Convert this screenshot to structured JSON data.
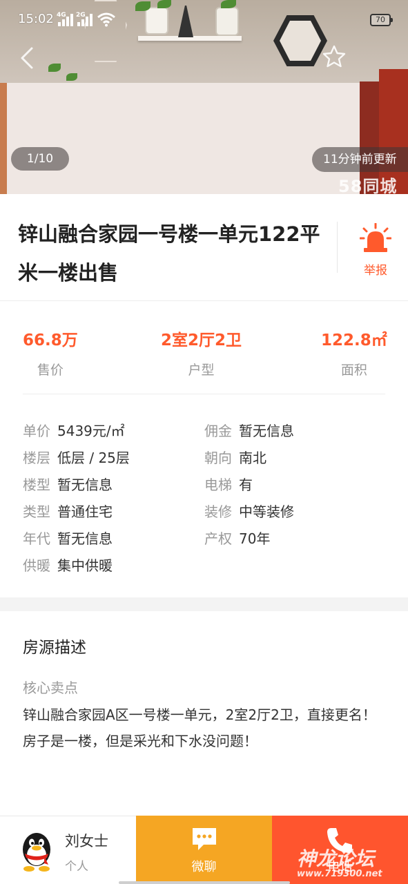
{
  "status_bar": {
    "time": "15:02",
    "signal1_label": "4G",
    "signal2_label": "2G",
    "battery": "70"
  },
  "gallery": {
    "counter": "1/10",
    "updated": "11分钟前更新",
    "watermark": "58同城"
  },
  "listing": {
    "title": "锌山融合家园一号楼一单元122平米一楼出售",
    "report_label": "举报"
  },
  "stats": [
    {
      "value": "66.8万",
      "label": "售价"
    },
    {
      "value": "2室2厅2卫",
      "label": "户型"
    },
    {
      "value": "122.8㎡",
      "label": "面积"
    }
  ],
  "details": [
    {
      "key": "单价",
      "value": "5439元/㎡"
    },
    {
      "key": "佣金",
      "value": "暂无信息"
    },
    {
      "key": "楼层",
      "value": "低层 / 25层"
    },
    {
      "key": "朝向",
      "value": "南北"
    },
    {
      "key": "楼型",
      "value": "暂无信息"
    },
    {
      "key": "电梯",
      "value": "有"
    },
    {
      "key": "类型",
      "value": "普通住宅"
    },
    {
      "key": "装修",
      "value": "中等装修"
    },
    {
      "key": "年代",
      "value": "暂无信息"
    },
    {
      "key": "产权",
      "value": "70年"
    },
    {
      "key": "供暖",
      "value": "集中供暖"
    }
  ],
  "description": {
    "title": "房源描述",
    "subtitle": "核心卖点",
    "body": "锌山融合家园A区一号楼一单元，2室2厅2卫，直接更名！房子是一楼，但是采光和下水没问题！"
  },
  "bottom_bar": {
    "agent_name": "刘女士",
    "agent_type": "个人",
    "chat_label": "微聊",
    "call_label": "电话"
  },
  "forum_watermark": {
    "text": "神龙论坛",
    "url": "www.719300.net"
  },
  "colors": {
    "accent": "#ff5a2c",
    "chat_bg": "#f5a623",
    "call_bg": "#ff552e"
  },
  "icons": [
    "back-arrow-icon",
    "star-icon",
    "alarm-light-icon",
    "qq-penguin-avatar",
    "chat-bubble-icon",
    "phone-icon"
  ]
}
